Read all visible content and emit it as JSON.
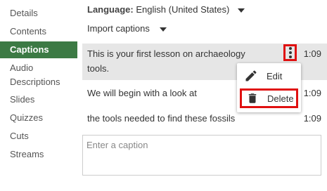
{
  "sidebar": {
    "items": [
      {
        "label": "Details"
      },
      {
        "label": "Contents"
      },
      {
        "label": "Captions",
        "active": true
      },
      {
        "label": "Audio Descriptions"
      },
      {
        "label": "Slides"
      },
      {
        "label": "Quizzes"
      },
      {
        "label": "Cuts"
      },
      {
        "label": "Streams"
      }
    ]
  },
  "header": {
    "language_label": "Language:",
    "language_value": "English (United States)",
    "import_label": "Import captions"
  },
  "captions": [
    {
      "text_line1": "This is your first lesson on archaeology",
      "text_line2": "tools.",
      "time": "1:09"
    },
    {
      "text": "We will begin with a look at",
      "time": "1:09"
    },
    {
      "text": "the tools needed to find these fossils",
      "time": "1:09"
    }
  ],
  "context_menu": {
    "edit_label": "Edit",
    "delete_label": "Delete"
  },
  "input": {
    "placeholder": "Enter a caption"
  },
  "colors": {
    "active_nav": "#3c7a44",
    "highlight": "#e01010",
    "selected_row": "#e6e6e6"
  }
}
